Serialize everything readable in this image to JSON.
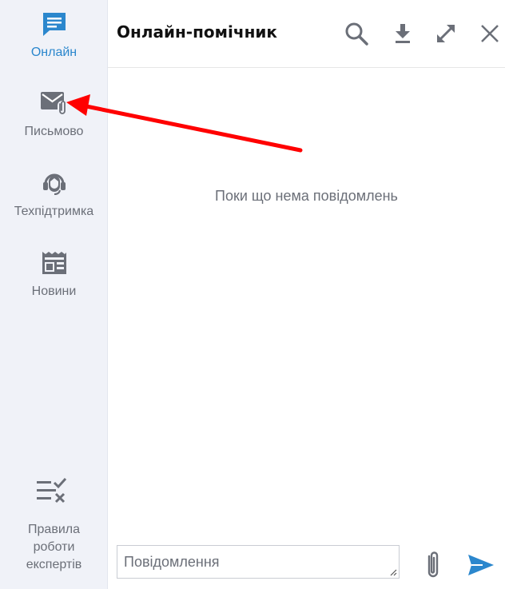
{
  "sidebar": {
    "items": [
      {
        "label": "Онлайн",
        "icon": "chat-icon",
        "active": true
      },
      {
        "label": "Письмово",
        "icon": "mail-attachment-icon",
        "active": false
      },
      {
        "label": "Техпідтримка",
        "icon": "headset-icon",
        "active": false
      },
      {
        "label": "Новини",
        "icon": "newspaper-icon",
        "active": false
      }
    ],
    "rules": {
      "label": "Правила роботи експертів",
      "icon": "checklist-icon"
    }
  },
  "header": {
    "title": "Онлайн-помічник",
    "actions": [
      "search-icon",
      "download-icon",
      "expand-icon",
      "close-icon"
    ]
  },
  "chat": {
    "empty_message": "Поки що нема повідомлень"
  },
  "composer": {
    "placeholder": "Повідомлення",
    "value": ""
  },
  "colors": {
    "accent": "#2b87cd",
    "icon_gray": "#6b6f78",
    "sidebar_bg": "#f0f2f8",
    "annotation_arrow": "#ff0000"
  }
}
